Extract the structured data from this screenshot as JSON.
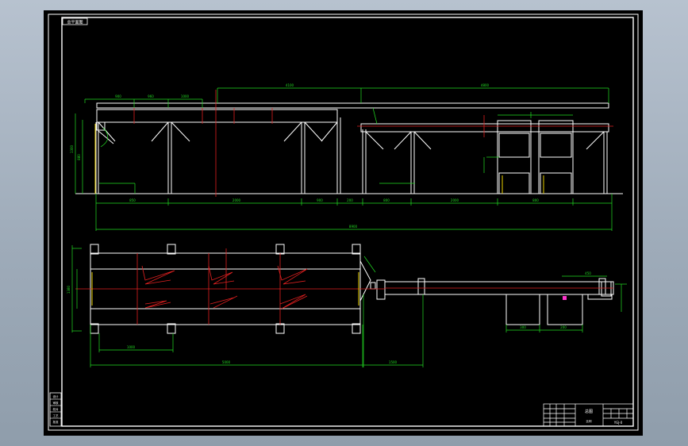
{
  "drawing": {
    "corner_tag": "总平面图",
    "dimensions": {
      "elev_top_left": "4100",
      "elev_top_right": "4800",
      "elev_seg1": "900",
      "elev_seg2": "960",
      "elev_seg3": "1000",
      "elev_bottom_1": "850",
      "elev_bottom_2": "2000",
      "elev_bottom_3": "900",
      "elev_bottom_4": "200",
      "elev_bottom_5": "800",
      "elev_bottom_6": "2000",
      "elev_bottom_7": "800",
      "elev_overall": "8900",
      "elev_height_1": "1300",
      "elev_height_2": "880",
      "plan_width": "1380",
      "plan_seg": "1000",
      "plan_overall": "5000",
      "plan_right": "1500",
      "plan_small_1": "450",
      "plan_small_2": "300",
      "plan_small_3": "200"
    }
  },
  "title_block": {
    "drawing_name": "总图",
    "scale_label": "比例",
    "drawing_number": "YGJ-0",
    "left_stack": [
      "设计",
      "审核",
      "校对",
      "工艺",
      "批准"
    ]
  },
  "colors": {
    "line_white": "#ffffff",
    "dim_green": "#22dd22",
    "center_red": "#e02020",
    "accent_yellow": "#e8d000",
    "accent_magenta": "#ff33cc"
  }
}
